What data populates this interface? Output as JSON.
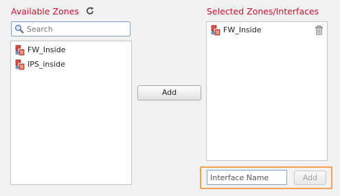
{
  "available": {
    "title": "Available Zones",
    "search_placeholder": "Search",
    "items": [
      {
        "label": "FW_Inside"
      },
      {
        "label": "IPS_inside"
      }
    ]
  },
  "actions": {
    "add_label": "Add"
  },
  "selected": {
    "title": "Selected Zones/Interfaces",
    "items": [
      {
        "label": "FW_Inside"
      }
    ]
  },
  "interface": {
    "placeholder": "Interface Name",
    "add_label": "Add"
  },
  "colors": {
    "heading": "#c8102e",
    "highlight_frame": "#f0a050"
  }
}
